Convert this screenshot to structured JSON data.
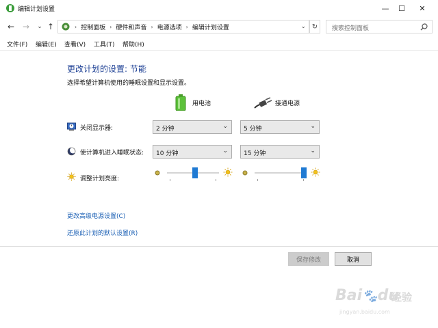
{
  "window": {
    "title": "编辑计划设置",
    "minimize_glyph": "—",
    "maximize_glyph": "☐",
    "close_glyph": "✕"
  },
  "nav": {
    "back_glyph": "←",
    "forward_glyph": "→",
    "recent_glyph": "⌄",
    "up_glyph": "↑",
    "breadcrumbs": [
      "控制面板",
      "硬件和声音",
      "电源选项",
      "编辑计划设置"
    ],
    "refresh_glyph": "↻",
    "search_placeholder": "搜索控制面板",
    "search_icon": "search-icon"
  },
  "menu": [
    "文件(F)",
    "编辑(E)",
    "查看(V)",
    "工具(T)",
    "帮助(H)"
  ],
  "content": {
    "heading": "更改计划的设置: 节能",
    "subtitle": "选择希望计算机使用的睡眠设置和显示设置。",
    "columns": {
      "battery": "用电池",
      "plugged": "接通电源"
    },
    "rows": {
      "display_off": {
        "label": "关闭显示器:",
        "battery": "2 分钟",
        "plugged": "5 分钟"
      },
      "sleep": {
        "label": "使计算机进入睡眠状态:",
        "battery": "10 分钟",
        "plugged": "15 分钟"
      },
      "brightness": {
        "label": "调整计划亮度:",
        "battery_level": 0.55,
        "plugged_level": 1.0
      }
    },
    "links": {
      "advanced": "更改高级电源设置(C)",
      "restore": "还原此计划的默认设置(R)"
    },
    "buttons": {
      "save": "保存修改",
      "cancel": "取消"
    }
  },
  "watermark": {
    "brand": "Bai",
    "paw": "🐾",
    "du": "du",
    "jingyan": "经验",
    "url": "jingyan.baidu.com"
  },
  "colors": {
    "accent": "#1f7ad3",
    "heading": "#1c3f94",
    "link": "#1a5fb4"
  }
}
